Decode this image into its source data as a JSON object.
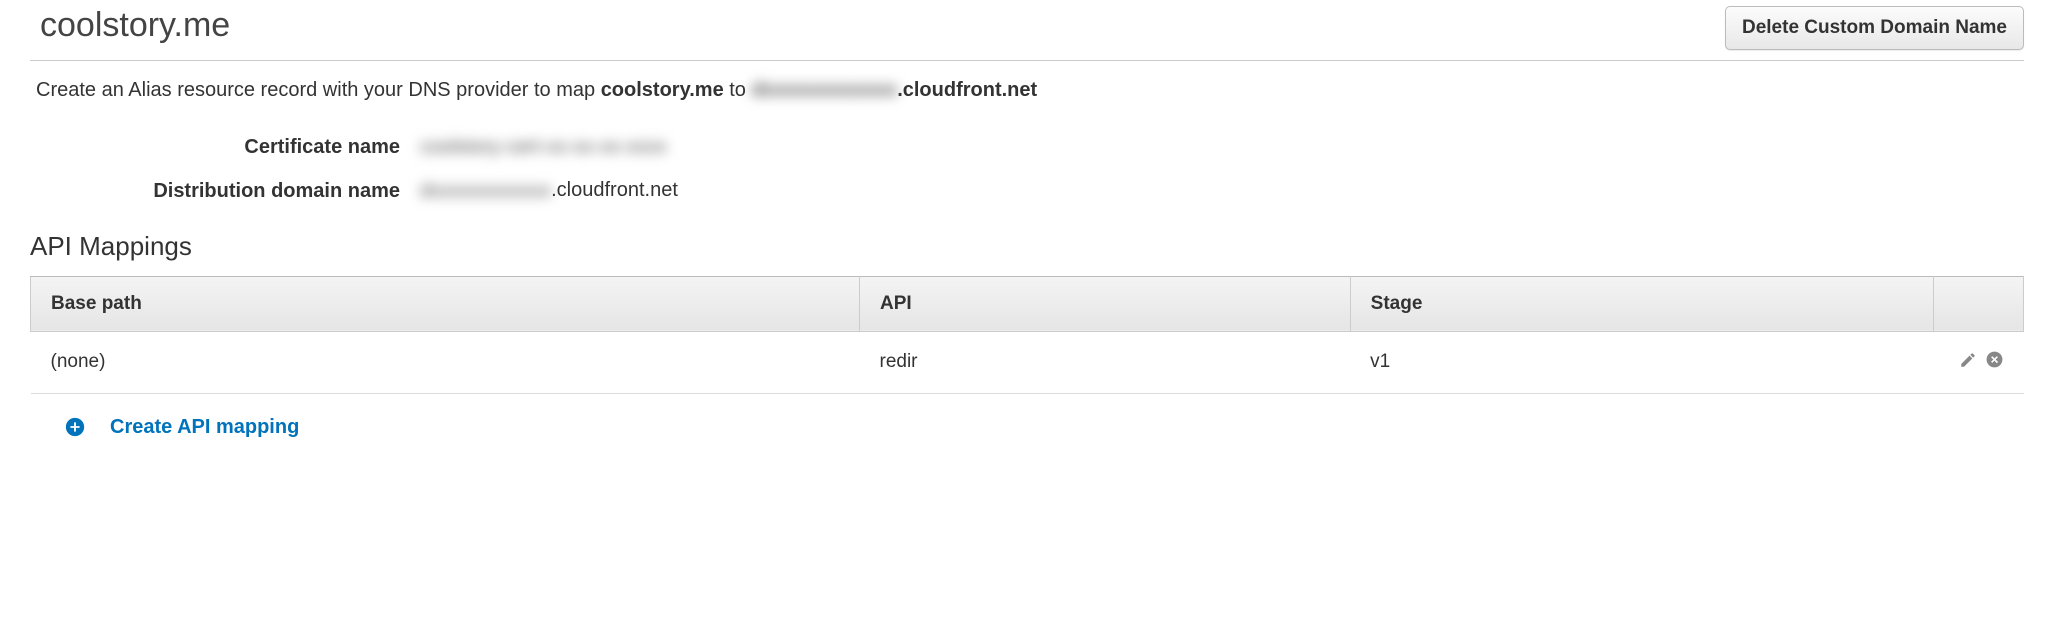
{
  "header": {
    "domain_title": "coolstory.me",
    "delete_button_label": "Delete Custom Domain Name"
  },
  "instructions": {
    "prefix": "Create an Alias resource record with your DNS provider to map ",
    "domain_bold": "coolstory.me",
    "middle": " to ",
    "target_redacted": "dxxxxxxxxxxxx",
    "target_suffix": ".cloudfront.net"
  },
  "fields": {
    "certificate_label": "Certificate name",
    "certificate_value_redacted": "coolstory-cert-xx-xx-xx-xxxx",
    "distribution_label": "Distribution domain name",
    "distribution_value_redacted": "dxxxxxxxxxxxx",
    "distribution_suffix": ".cloudfront.net"
  },
  "api_mappings": {
    "section_title": "API Mappings",
    "columns": {
      "base_path": "Base path",
      "api": "API",
      "stage": "Stage"
    },
    "rows": [
      {
        "base_path": "(none)",
        "api": "redir",
        "stage": "v1"
      }
    ],
    "create_label": "Create API mapping"
  }
}
